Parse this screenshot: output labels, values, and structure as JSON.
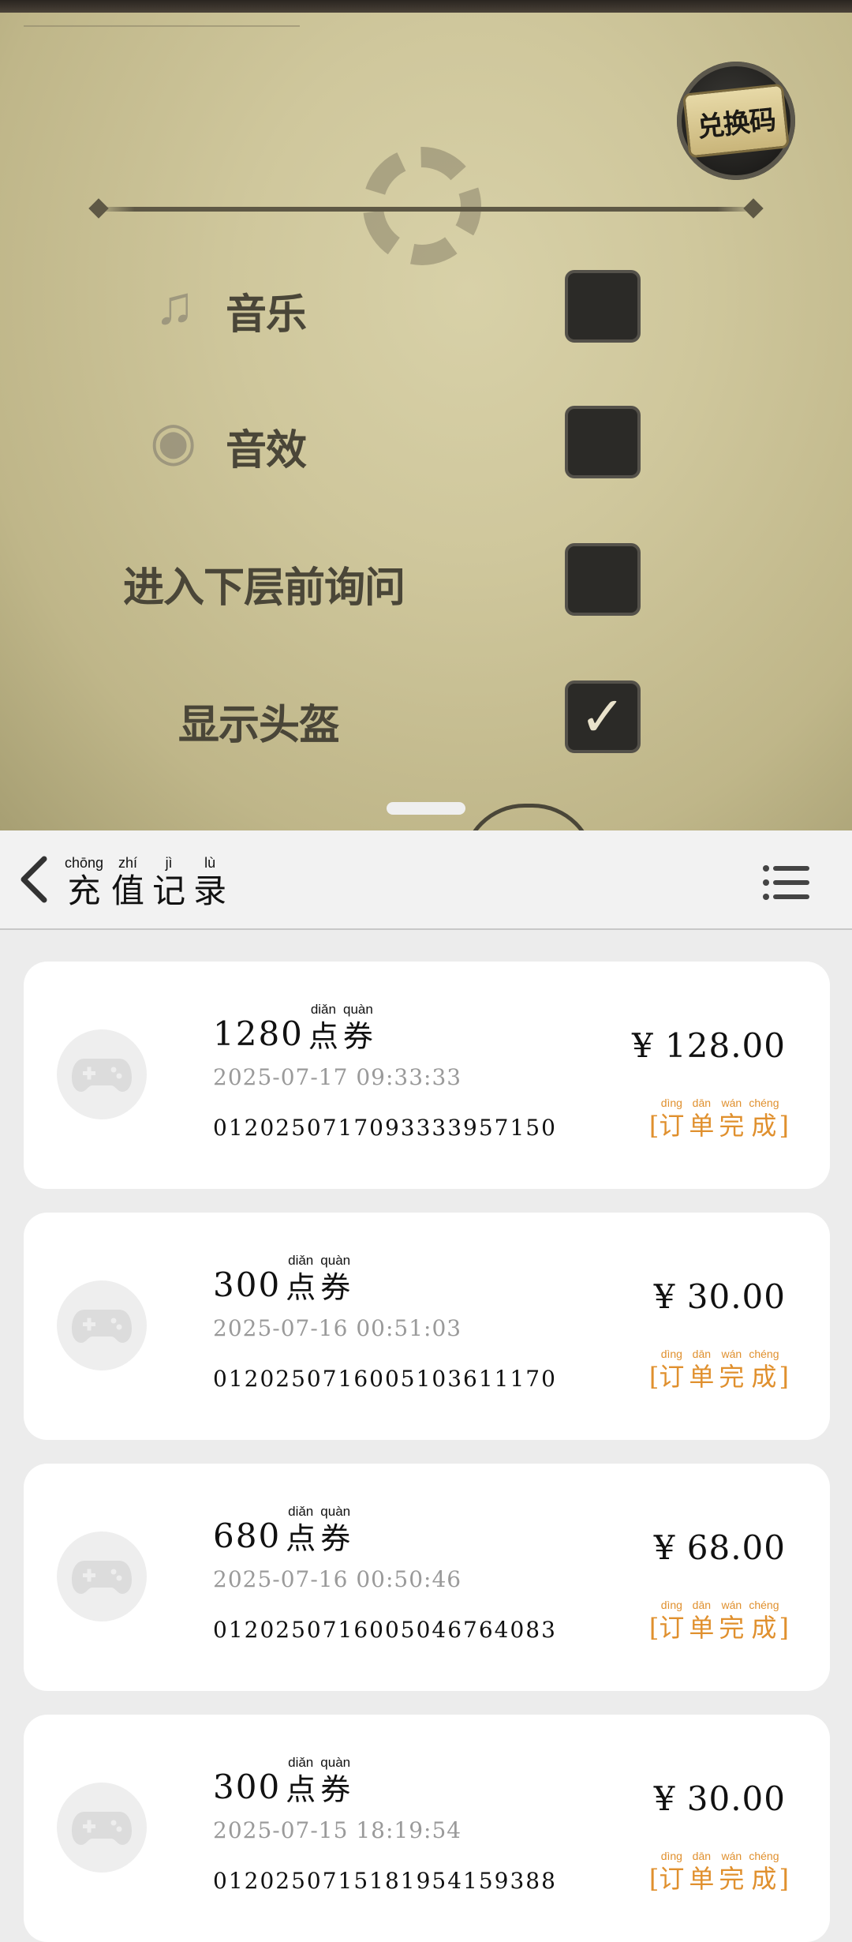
{
  "game_settings": {
    "redeem_button": "兑换码",
    "items": [
      {
        "label": "音乐",
        "icon": "music-note-icon",
        "checked": false
      },
      {
        "label": "音效",
        "icon": "sound-wave-icon",
        "checked": false
      },
      {
        "label": "进入下层前询问",
        "icon": "",
        "checked": false
      },
      {
        "label": "显示头盔",
        "icon": "",
        "checked": true
      }
    ]
  },
  "header": {
    "title": [
      {
        "py": "chōng",
        "hz": "充"
      },
      {
        "py": "zhí",
        "hz": "值"
      },
      {
        "py": "jì",
        "hz": "记"
      },
      {
        "py": "lù",
        "hz": "录"
      }
    ],
    "back_icon": "chevron-left-icon",
    "menu_icon": "list-menu-icon"
  },
  "unit": [
    {
      "py": "diǎn",
      "hz": "点"
    },
    {
      "py": "quàn",
      "hz": "券"
    }
  ],
  "status": {
    "open": "[",
    "close": "]",
    "chars": [
      {
        "py": "dìng",
        "hz": "订"
      },
      {
        "py": "dān",
        "hz": "单"
      },
      {
        "py": "wán",
        "hz": "完"
      },
      {
        "py": "chéng",
        "hz": "成"
      }
    ],
    "color": "#e0902e"
  },
  "orders": [
    {
      "amount": "1280",
      "date": "2025-07-17 09:33:33",
      "order_no": "0120250717093333957150",
      "price": "¥ 128.00"
    },
    {
      "amount": "300",
      "date": "2025-07-16 00:51:03",
      "order_no": "0120250716005103611170",
      "price": "¥ 30.00"
    },
    {
      "amount": "680",
      "date": "2025-07-16 00:50:46",
      "order_no": "0120250716005046764083",
      "price": "¥ 68.00"
    },
    {
      "amount": "300",
      "date": "2025-07-15 18:19:54",
      "order_no": "0120250715181954159388",
      "price": "¥ 30.00"
    }
  ]
}
